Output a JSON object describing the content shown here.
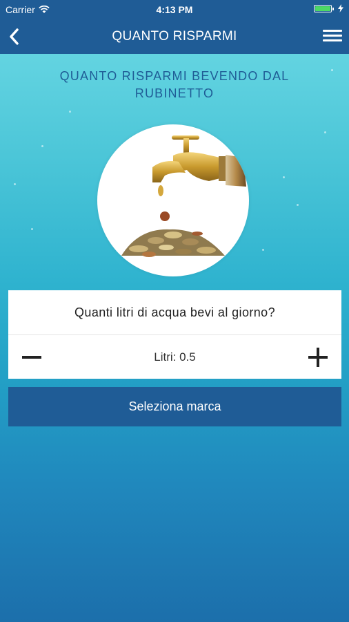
{
  "status_bar": {
    "carrier": "Carrier",
    "time": "4:13 PM"
  },
  "nav": {
    "title": "QUANTO RISPARMI",
    "back_icon": "chevron-left-icon",
    "menu_icon": "hamburger-menu-icon"
  },
  "headline": "QUANTO RISPARMI BEVENDO DAL RUBINETTO",
  "illustration": "faucet-coins-image",
  "question": "Quanti litri di acqua bevi al giorno?",
  "stepper": {
    "value_text": "Litri: 0.5",
    "minus_icon": "minus-icon",
    "plus_icon": "plus-icon"
  },
  "select_brand_label": "Seleziona marca",
  "colors": {
    "primary": "#1f5c96",
    "background_top": "#6fdbe6",
    "background_bottom": "#1c6fab",
    "battery": "#4cd964"
  }
}
